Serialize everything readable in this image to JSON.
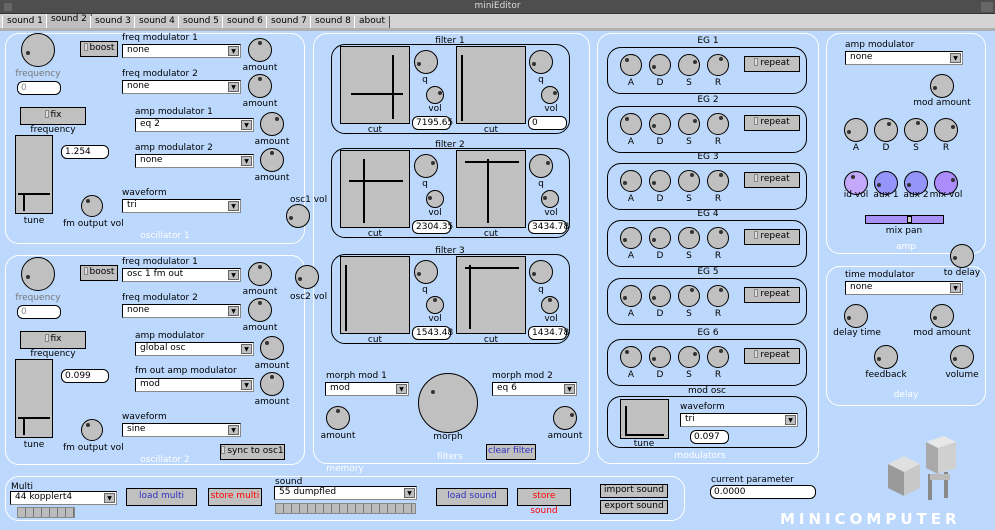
{
  "window": {
    "title": "miniEditor"
  },
  "tabs": [
    "sound 1",
    "sound 2",
    "sound 3",
    "sound 4",
    "sound 5",
    "sound 6",
    "sound 7",
    "sound 8",
    "about"
  ],
  "active_tab": 1,
  "common": {
    "amount": "amount",
    "tune": "tune",
    "waveform": "waveform",
    "cut": "cut",
    "q": "q",
    "vol": "vol",
    "A": "A",
    "D": "D",
    "S": "S",
    "R": "R",
    "repeat": "repeat"
  },
  "osc1": {
    "title": "oscillator 1",
    "frequency_label": "frequency",
    "frequency_value": "0",
    "boost": "boost",
    "fix_frequency": "fix frequency",
    "freq_mod1_label": "freq modulator 1",
    "freq_mod1": "none",
    "freq_mod2_label": "freq modulator 2",
    "freq_mod2": "none",
    "amp_mod1_label": "amp modulator 1",
    "amp_mod1": "eq 2",
    "amp_mod2_label": "amp modulator 2",
    "amp_mod2": "none",
    "tune_value": "1.254",
    "waveform": "tri",
    "fm_output_label": "fm output  vol",
    "vol_label": "osc1  vol"
  },
  "osc2": {
    "title": "oscillator 2",
    "frequency_label": "frequency",
    "frequency_value": "0",
    "boost": "boost",
    "fix_frequency": "fix frequency",
    "freq_mod1_label": "freq modulator 1",
    "freq_mod1": "osc 1 fm out",
    "freq_mod2_label": "freq modulator 2",
    "freq_mod2": "none",
    "amp_mod_label": "amp modulator",
    "amp_mod": "global osc",
    "fm_amp_mod_label": "fm out amp modulator",
    "fm_amp_mod": "mod",
    "tune_value": "0.099",
    "waveform": "sine",
    "fm_output_label": "fm output  vol",
    "sync": "sync to osc1",
    "vol_label": "osc2  vol"
  },
  "filters": {
    "title": "filters",
    "groups": [
      {
        "title": "filter 1",
        "values": [
          "7195.65",
          "0"
        ]
      },
      {
        "title": "filter 2",
        "values": [
          "2304.35",
          "3434.78"
        ]
      },
      {
        "title": "filter 3",
        "values": [
          "1543.48",
          "1434.78"
        ]
      }
    ],
    "morph_mod1_label": "morph mod 1",
    "morph_mod1": "mod",
    "morph_mod2_label": "morph mod 2",
    "morph_mod2": "eq 6",
    "morph": "morph",
    "clear": "clear filter"
  },
  "modulators": {
    "title": "modulators",
    "egs": [
      "EG 1",
      "EG 2",
      "EG 3",
      "EG 4",
      "EG 5",
      "EG 6"
    ],
    "mod_osc": {
      "title": "mod osc",
      "waveform": "tri",
      "value": "0.097"
    }
  },
  "amp": {
    "title": "amp",
    "amp_mod_label": "amp modulator",
    "amp_mod": "none",
    "mod_amount": "mod amount",
    "id_vol": "id vol",
    "aux1": "aux 1",
    "aux2": "aux 2",
    "mix_vol": "mix vol",
    "mix_pan": "mix pan",
    "mix_pan_value": 0.57,
    "to_delay": "to delay",
    "colors": {
      "id_vol": "#c4a8fa",
      "aux": "#9494fa",
      "mix_vol": "#aa8cfa",
      "pan": "#a890f8"
    }
  },
  "delay": {
    "title": "delay",
    "time_mod_label": "time modulator",
    "time_mod": "none",
    "delay_time": "delay time",
    "mod_amount": "mod amount",
    "feedback": "feedback",
    "volume": "volume"
  },
  "memory": {
    "title": "memory",
    "multi_label": "Multi",
    "multi": "44 kopplert4",
    "load_multi": "load multi",
    "store_multi": "store multi",
    "sound_label": "sound",
    "sound": "55 dumpfled",
    "load_sound": "load sound",
    "store_sound": "store sound",
    "import_sound": "import sound",
    "export_sound": "export sound"
  },
  "current_parameter": {
    "label": "current parameter",
    "value": "0.0000"
  },
  "logo": "MINICOMPUTER",
  "knob_values": {
    "osc1_freq": 0.1,
    "osc1_fm1": 0.5,
    "osc1_fm2": 0.5,
    "osc1_am1": 0.65,
    "osc1_am2": 0.5,
    "osc1_fmout": 0.35,
    "osc1_vol": 0.1,
    "osc2_freq": 0.1,
    "osc2_fm1": 0.5,
    "osc2_fm2": 0.5,
    "osc2_am": 0.35,
    "osc2_fam": 0.5,
    "osc2_fmout": 0.35,
    "osc2_vol": 0.1,
    "f1q1": 0.1,
    "f1v1": 0.75,
    "f1q2": 0.1,
    "f1v2": 0.75,
    "f2q1": 0.75,
    "f2v1": 0.2,
    "f2q2": 0.75,
    "f2v2": 0.2,
    "f3q1": 0.1,
    "f3v1": 0.5,
    "f3q2": 0.1,
    "f3v2": 0.5,
    "morph_am1": 0.5,
    "morph": 0.3,
    "morph_am2": 0.75,
    "eg": [
      [
        0.35,
        0.1,
        0.75,
        0.6
      ],
      [
        0.35,
        0.1,
        0.75,
        0.6
      ],
      [
        0.1,
        0.1,
        0.6,
        0.6
      ],
      [
        0.1,
        0.1,
        0.6,
        0.6
      ],
      [
        0.1,
        0.1,
        0.6,
        0.6
      ],
      [
        0.35,
        0.1,
        0.75,
        0.6
      ]
    ],
    "amp_mod": 0.1,
    "amp_adsr": [
      0.1,
      0.6,
      0.55,
      0.75
    ],
    "id_vol": 0.4,
    "aux1": 0.1,
    "aux2": 0.1,
    "mix_vol": 0.75,
    "to_delay": 0.1,
    "delay_time": 0.1,
    "delay_mod": 0.1,
    "feedback": 0.1,
    "volume": 0.1
  }
}
